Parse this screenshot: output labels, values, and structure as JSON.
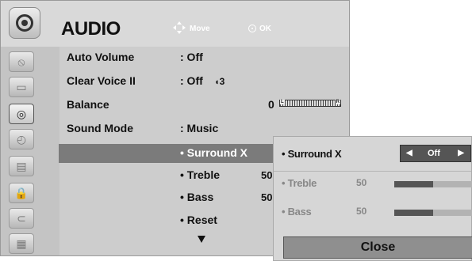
{
  "header": {
    "title": "AUDIO",
    "move_hint": "Move",
    "ok_hint": "OK"
  },
  "sidebar": {
    "items": [
      {
        "icon": "satellite-dish-icon",
        "glyph": "⦸"
      },
      {
        "icon": "monitor-icon",
        "glyph": "▭"
      },
      {
        "icon": "speaker-icon",
        "glyph": "◎"
      },
      {
        "icon": "clock-icon",
        "glyph": "◴"
      },
      {
        "icon": "option-briefcase-icon",
        "glyph": "▤"
      },
      {
        "icon": "lock-icon",
        "glyph": "🔒"
      },
      {
        "icon": "input-connector-icon",
        "glyph": "⊂"
      },
      {
        "icon": "usb-media-icon",
        "glyph": "▦"
      }
    ]
  },
  "menu": {
    "auto_volume": {
      "label": "Auto Volume",
      "value": ": Off"
    },
    "clear_voice": {
      "label": "Clear Voice II",
      "value": ": Off",
      "level": "3"
    },
    "balance": {
      "label": "Balance",
      "value": "0",
      "left": "L",
      "right": "R"
    },
    "sound_mode": {
      "label": "Sound Mode",
      "value": ": Music"
    },
    "sub_items": {
      "surround": "• Surround X",
      "treble": "• Treble",
      "treble_value": "50",
      "bass": "• Bass",
      "bass_value": "50",
      "reset": "• Reset"
    }
  },
  "popup": {
    "surround_label": "• Surround X",
    "surround_value": "Off",
    "treble_label": "• Treble",
    "treble_value": "50",
    "treble_level": 0.5,
    "bass_label": "• Bass",
    "bass_value": "50",
    "bass_level": 0.5,
    "close_label": "Close"
  }
}
